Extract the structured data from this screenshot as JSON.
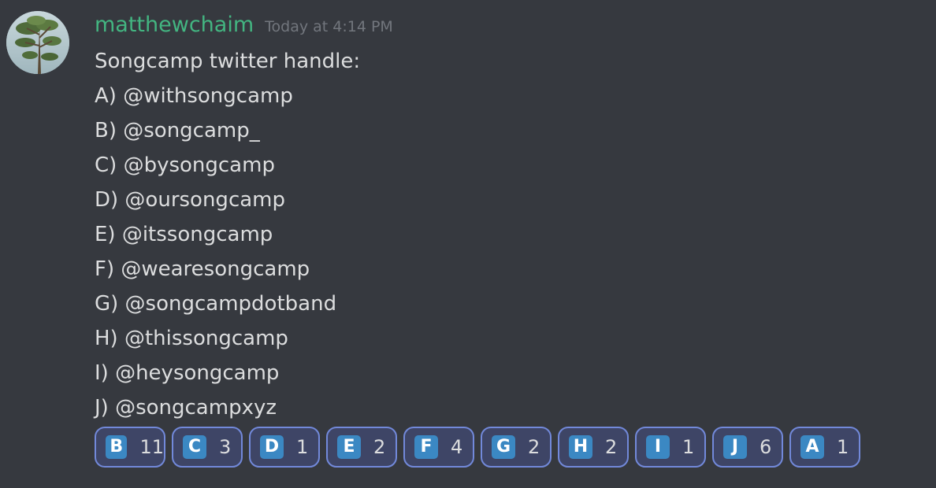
{
  "message": {
    "author": "matthewchaim",
    "timestamp": "Today at 4:14 PM",
    "lines": [
      "Songcamp twitter handle:",
      "A) @withsongcamp",
      "B) @songcamp_",
      "C) @bysongcamp",
      "D) @oursongcamp",
      "E) @itssongcamp",
      "F) @wearesongcamp",
      "G) @songcampdotband",
      "H) @thissongcamp",
      "I) @heysongcamp",
      "J) @songcampxyz"
    ],
    "reactions": [
      {
        "emoji": "B",
        "count": "11"
      },
      {
        "emoji": "C",
        "count": "3"
      },
      {
        "emoji": "D",
        "count": "1"
      },
      {
        "emoji": "E",
        "count": "2"
      },
      {
        "emoji": "F",
        "count": "4"
      },
      {
        "emoji": "G",
        "count": "2"
      },
      {
        "emoji": "H",
        "count": "2"
      },
      {
        "emoji": "I",
        "count": "1"
      },
      {
        "emoji": "J",
        "count": "6"
      },
      {
        "emoji": "A",
        "count": "1"
      }
    ]
  },
  "colors": {
    "background": "#36393f",
    "username": "#43b581",
    "timestamp": "#72767d",
    "text": "#dcddde",
    "reaction_border": "#7289da",
    "reaction_bg": "#3e4566",
    "emoji_bg": "#3b88c3"
  },
  "icons": {
    "avatar": "tree-avatar-icon",
    "reaction_emoji": "regional-indicator-letter-icon"
  }
}
